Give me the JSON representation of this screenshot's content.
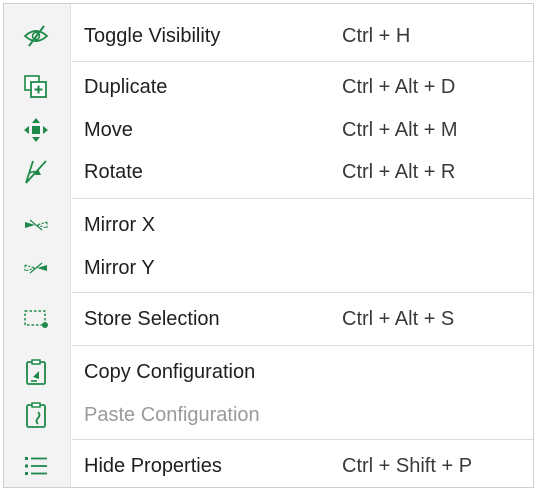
{
  "menu": {
    "items": [
      {
        "label": "Toggle Visibility",
        "shortcut": "Ctrl + H",
        "icon": "eye-slash-icon"
      },
      {
        "label": "Duplicate",
        "shortcut": "Ctrl + Alt + D",
        "icon": "duplicate-icon"
      },
      {
        "label": "Move",
        "shortcut": "Ctrl + Alt + M",
        "icon": "move-arrows-icon"
      },
      {
        "label": "Rotate",
        "shortcut": "Ctrl + Alt + R",
        "icon": "rotate-icon"
      },
      {
        "label": "Mirror X",
        "shortcut": "",
        "icon": "mirror-x-icon"
      },
      {
        "label": "Mirror Y",
        "shortcut": "",
        "icon": "mirror-y-icon"
      },
      {
        "label": "Store Selection",
        "shortcut": "Ctrl + Alt + S",
        "icon": "store-selection-icon"
      },
      {
        "label": "Copy Configuration",
        "shortcut": "",
        "icon": "clipboard-copy-icon"
      },
      {
        "label": "Paste Configuration",
        "shortcut": "",
        "icon": "clipboard-paste-icon",
        "disabled": true
      },
      {
        "label": "Hide Properties",
        "shortcut": "Ctrl + Shift + P",
        "icon": "list-icon"
      }
    ]
  },
  "colors": {
    "icon_green": "#1e8a4a",
    "text": "#1f1f1f",
    "disabled_text": "#9a9a9a"
  }
}
